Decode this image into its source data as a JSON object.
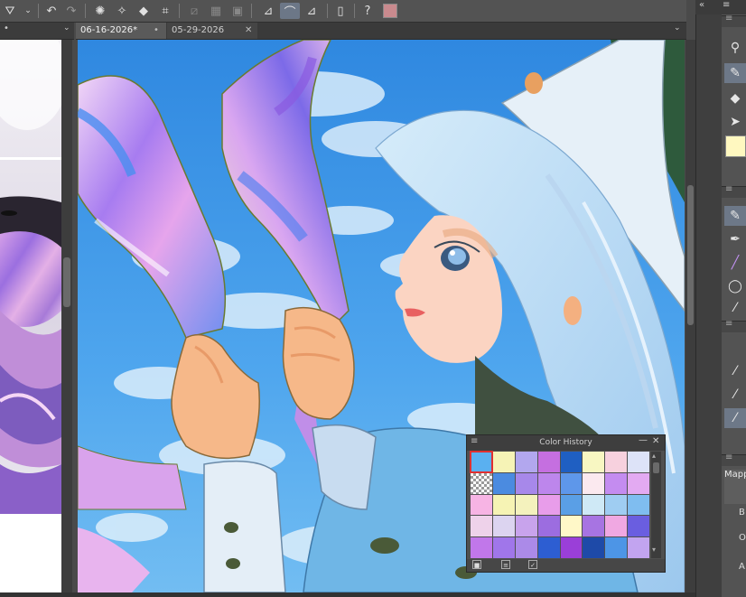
{
  "tabs": [
    {
      "label": "06-16-2026*",
      "active": true
    },
    {
      "label": "05-29-2026",
      "active": false
    }
  ],
  "color_history": {
    "title": "Color History",
    "selected_index": 0,
    "swatches": [
      "#5ab0f0",
      "#f6f3b6",
      "#b2a7ee",
      "#c56fe0",
      "#1f5fc2",
      "#f8f7c2",
      "#f7d1de",
      "#dde3f8",
      "checker",
      "#4b8be0",
      "#a788ea",
      "#bd86ec",
      "#5e97ea",
      "#fbe9ef",
      "#c48cf0",
      "#e3aaf2",
      "#f7b4e4",
      "#f6f3b4",
      "#f4f2bd",
      "#e89dea",
      "#5a9fe6",
      "#cfe9f6",
      "#9fcdf2",
      "#7fbdf0",
      "#eed2ea",
      "#dcd4f0",
      "#c8a3ec",
      "#9c6de0",
      "#fff8c8",
      "#a774e2",
      "#f0a8e2",
      "#6a5ee0",
      "#c177ea",
      "#a076ea",
      "#ab8ae8",
      "#2d5ed2",
      "#9a3fd8",
      "#1e4aa8",
      "#4d95e6",
      "#c2a4f0"
    ]
  },
  "right_panel": {
    "labels": [
      "Mapp",
      "B",
      "O",
      "A"
    ]
  },
  "colors": {
    "main_color": "#fff8c0",
    "ui_dark": "#3a3a3a",
    "ui_mid": "#535353",
    "selection": "#6d7888"
  },
  "icons": {
    "toolbar": [
      "brush-tool-icon",
      "undo-icon",
      "redo-icon",
      "loading-icon",
      "fill-icon",
      "transform-icon",
      "grid-icon",
      "ruler-icon",
      "pen-stabilizer-icon",
      "device-icon",
      "help-icon"
    ],
    "tools": [
      "zoom-icon",
      "pen-icon",
      "fill-icon",
      "select-icon",
      "pen-icon",
      "brush-icon",
      "lasso-icon"
    ]
  }
}
